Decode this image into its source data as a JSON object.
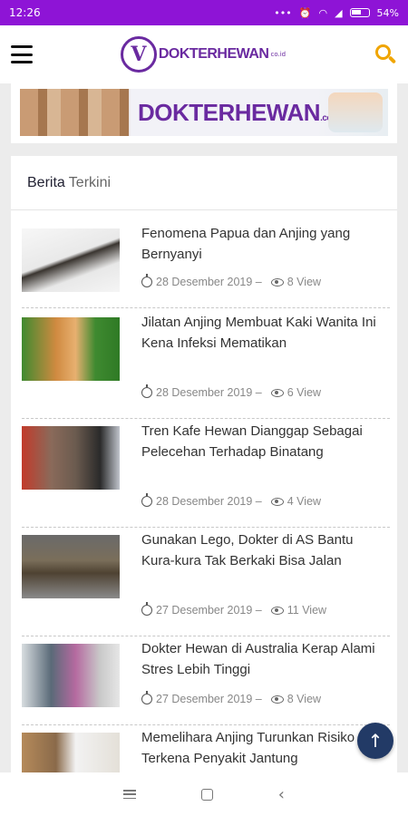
{
  "status": {
    "time": "12:26",
    "battery": "54%"
  },
  "header": {
    "logo_text": "DOKTERHEWAN",
    "logo_suffix": "co.id"
  },
  "banner": {
    "text": "DOKTERHEWAN",
    "suffix": ".co.id"
  },
  "section": {
    "title_bold": "Berita",
    "title_rest": "Terkini"
  },
  "articles": [
    {
      "title": "Fenomena Papua dan Anjing yang Bernyanyi",
      "date": "28 Desember 2019 –",
      "views": "8 View"
    },
    {
      "title": "Jilatan Anjing Membuat Kaki Wanita Ini Kena Infeksi Mematikan",
      "date": "28 Desember 2019 –",
      "views": "6 View"
    },
    {
      "title": "Tren Kafe Hewan Dianggap Sebagai Pelecehan Terhadap Binatang",
      "date": "28 Desember 2019 –",
      "views": "4 View"
    },
    {
      "title": "Gunakan Lego, Dokter di AS Bantu Kura-kura Tak Berkaki Bisa Jalan",
      "date": "27 Desember 2019 –",
      "views": "11 View"
    },
    {
      "title": "Dokter Hewan di Australia Kerap Alami Stres Lebih Tinggi",
      "date": "27 Desember 2019 –",
      "views": "8 View"
    },
    {
      "title": "Memelihara Anjing Turunkan Risiko Terkena Penyakit Jantung",
      "date": "",
      "views": ""
    }
  ],
  "colors": {
    "statusbar": "#8e14d6",
    "brand": "#6a2aa0",
    "search": "#f0a500",
    "fab": "#223a66"
  }
}
